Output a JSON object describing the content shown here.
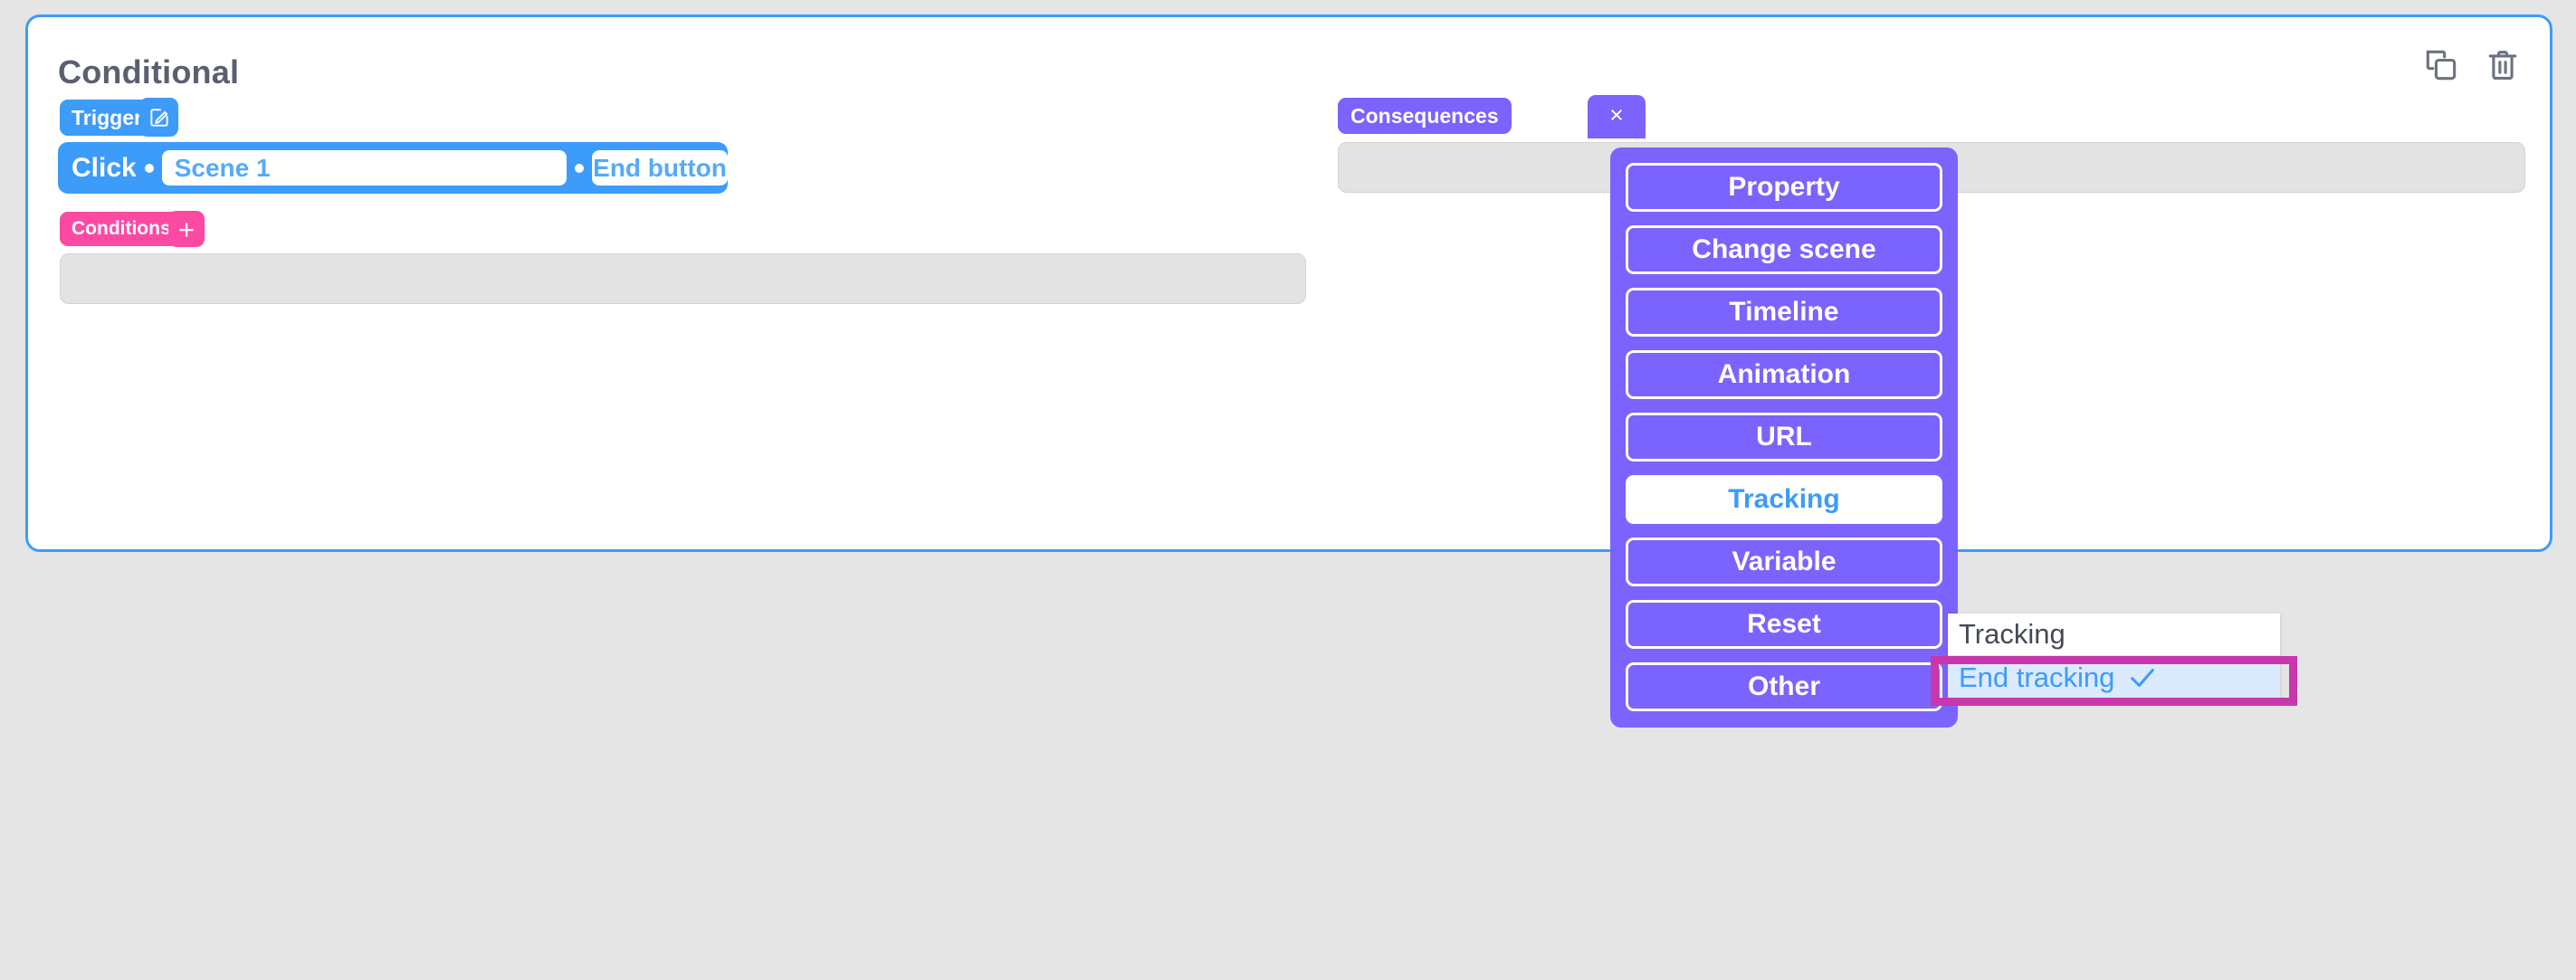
{
  "card": {
    "title": "Conditional",
    "border_color": "#3D9BFA",
    "icons": {
      "duplicate": "duplicate-icon",
      "delete": "trash-icon"
    }
  },
  "trigger": {
    "badge_label": "Trigger",
    "edit_icon": "edit-square-icon",
    "event": "Click",
    "target_value": "Scene 1",
    "element_value": "End button",
    "bar_color": "#3D9BFA",
    "field_text_color": "#55AAFB"
  },
  "conditions": {
    "badge_label": "Conditions",
    "add_label": "+",
    "badge_color": "#FC4AA3",
    "panel_items": []
  },
  "consequences": {
    "badge_label": "Consequences",
    "close_label": "×",
    "badge_color": "#7B63FE",
    "panel_items": []
  },
  "consequence_type_menu": {
    "background": "#7B63FE",
    "items": [
      {
        "label": "Property",
        "active": false
      },
      {
        "label": "Change scene",
        "active": false
      },
      {
        "label": "Timeline",
        "active": false
      },
      {
        "label": "Animation",
        "active": false
      },
      {
        "label": "URL",
        "active": false
      },
      {
        "label": "Tracking",
        "active": true
      },
      {
        "label": "Variable",
        "active": false
      },
      {
        "label": "Reset",
        "active": false
      },
      {
        "label": "Other",
        "active": false
      }
    ]
  },
  "tracking_submenu": {
    "header": "Tracking",
    "selected_item": "End tracking",
    "check_icon": "check-icon",
    "highlight_color": "#C837AB",
    "selected_bg": "#dbeafc",
    "selected_text_color": "#3D9BFA"
  }
}
